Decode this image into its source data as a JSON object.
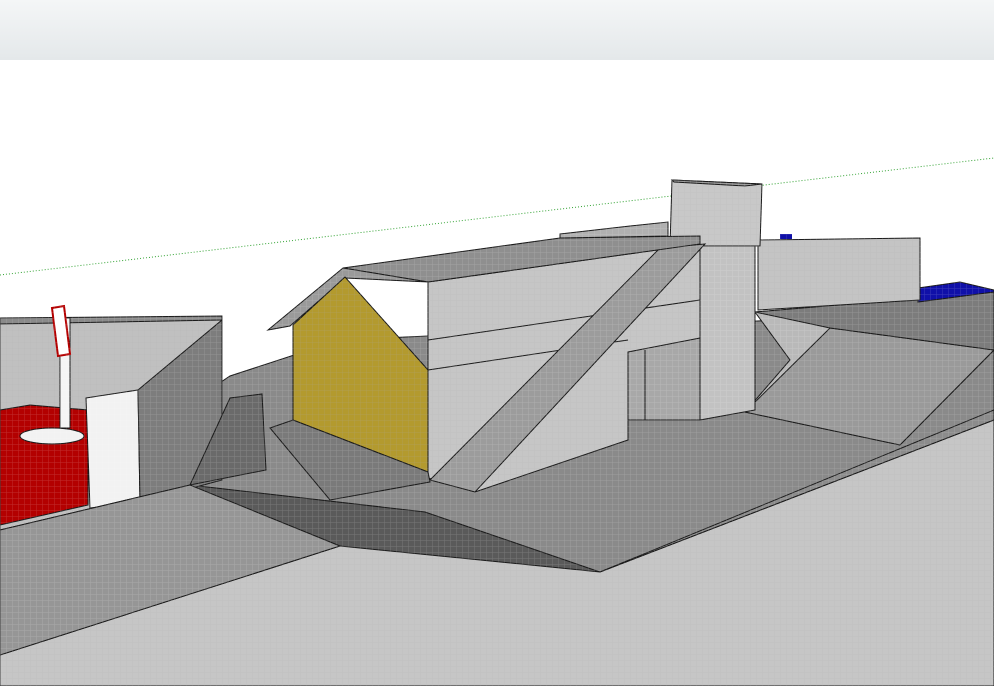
{
  "window": {
    "toolbar_state": "empty"
  },
  "viewport": {
    "view": "perspective",
    "colors": {
      "background": "#ffffff",
      "face_front": "#c8c8c8",
      "face_shadow": "#8c8c8c",
      "face_dark": "#6e6e6e",
      "ground_shadow": "#5a5a5a",
      "gable_wall": "#b39a2e",
      "red_surface": "#b30000",
      "blue_surface": "#1010a8",
      "white_element": "#f2f2f2",
      "edge": "#1a1a1a"
    },
    "axes": {
      "green_axis": "#2ea02e",
      "red_axis": "#c03030"
    }
  }
}
